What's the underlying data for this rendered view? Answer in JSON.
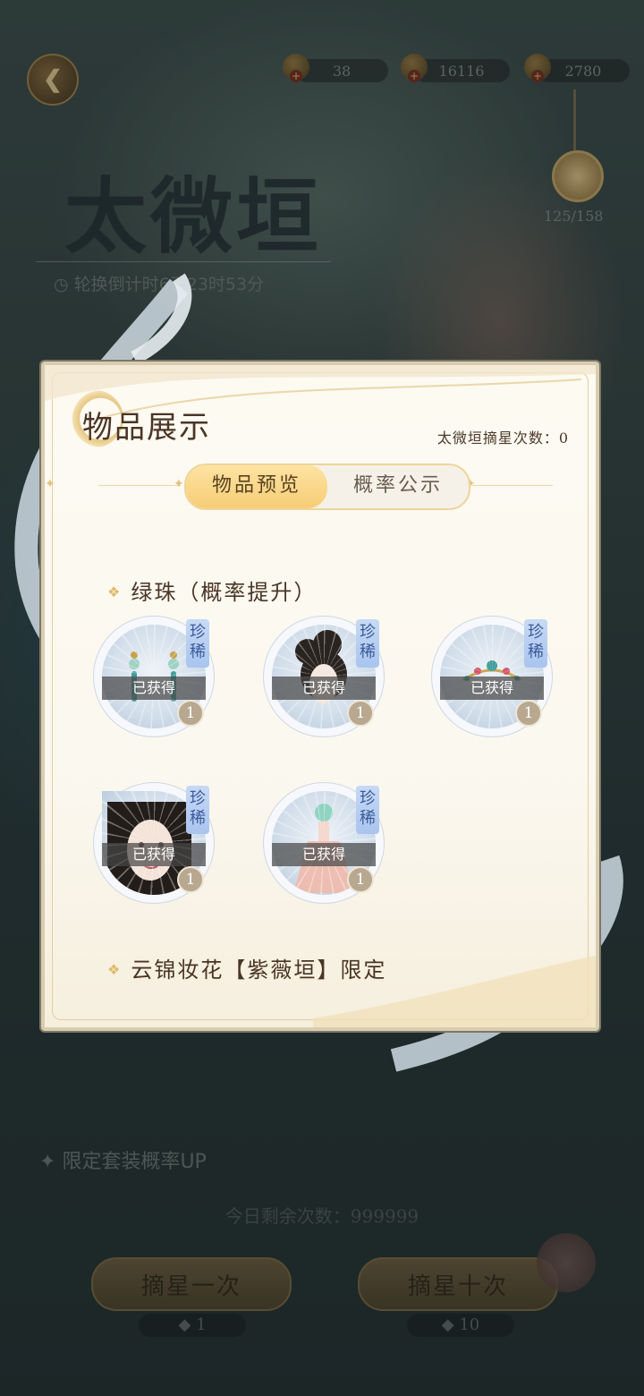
{
  "header": {
    "banner_title": "太微垣",
    "countdown": "轮换倒计时6天23时53分",
    "resources": [
      {
        "name": "star-crystal",
        "value": "38"
      },
      {
        "name": "gold-coin",
        "value": "16116"
      },
      {
        "name": "pearl",
        "value": "2780"
      }
    ],
    "medal_progress": "125/158"
  },
  "modal": {
    "title": "物品展示",
    "star_pick_count": "太微垣摘星次数：0",
    "tabs": [
      {
        "label": "物品预览",
        "active": true
      },
      {
        "label": "概率公示",
        "active": false
      }
    ],
    "section1_title": "绿珠（概率提升）",
    "section2_title": "云锦妆花【紫薇垣】限定",
    "items": [
      {
        "kind": "earrings",
        "badge": "珍稀",
        "status": "已获得",
        "qty": "1"
      },
      {
        "kind": "hairstyle",
        "badge": "珍稀",
        "status": "已获得",
        "qty": "1"
      },
      {
        "kind": "headpiece",
        "badge": "珍稀",
        "status": "已获得",
        "qty": "1"
      },
      {
        "kind": "makeup",
        "badge": "珍稀",
        "status": "已获得",
        "qty": "1"
      },
      {
        "kind": "dress",
        "badge": "珍稀",
        "status": "已获得",
        "qty": "1"
      }
    ]
  },
  "footer": {
    "limit_label": "限定套装概率UP",
    "remaining": "今日剩余次数：999999",
    "draw_once": "摘星一次",
    "draw_ten": "摘星十次",
    "cost_once": "1",
    "cost_ten": "10"
  },
  "colors": {
    "accent_gold": "#f6cd76",
    "title_brown": "#4a3524",
    "rare_badge_blue": "#a9c4ee"
  }
}
